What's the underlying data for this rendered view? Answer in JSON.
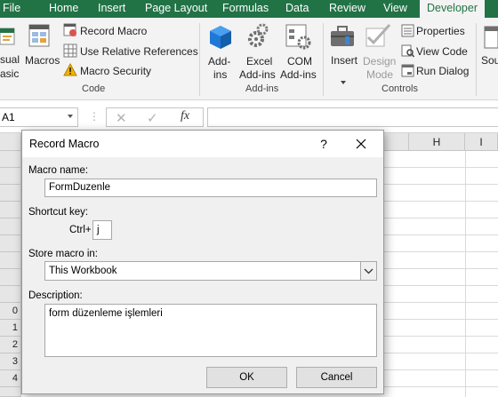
{
  "ribbon_tabs": [
    "File",
    "Home",
    "Insert",
    "Page Layout",
    "Formulas",
    "Data",
    "Review",
    "View",
    "Developer"
  ],
  "code_group": {
    "visual_basic_label_1": "sual",
    "visual_basic_label_2": "asic",
    "macros_label": "Macros",
    "record_macro_label": "Record Macro",
    "relative_refs_label": "Use Relative References",
    "macro_security_label": "Macro Security",
    "group_label": "Code"
  },
  "addins_group": {
    "addins_label_1": "Add-",
    "addins_label_2": "ins",
    "excel_addins_label_1": "Excel",
    "excel_addins_label_2": "Add-ins",
    "com_addins_label_1": "COM",
    "com_addins_label_2": "Add-ins",
    "group_label": "Add-ins"
  },
  "controls_group": {
    "insert_label": "Insert",
    "design_mode_label_1": "Design",
    "design_mode_label_2": "Mode",
    "properties_label": "Properties",
    "view_code_label": "View Code",
    "run_dialog_label": "Run Dialog",
    "group_label": "Controls"
  },
  "source_label": "Sou",
  "formula_bar": {
    "name_box": "A1",
    "fx_label": "fx",
    "formula_value": ""
  },
  "columns": [
    "H",
    "I"
  ],
  "rows": [
    "0",
    "1",
    "2",
    "3",
    "4"
  ],
  "dialog": {
    "title": "Record Macro",
    "help_label": "?",
    "macro_name_label": "Macro name:",
    "macro_name_value": "FormDuzenle",
    "shortcut_key_label": "Shortcut key:",
    "ctrl_label": "Ctrl+",
    "shortcut_value": "j",
    "store_macro_label": "Store macro in:",
    "store_macro_value": "This Workbook",
    "description_label": "Description:",
    "description_value": "form düzenleme işlemleri",
    "ok_label": "OK",
    "cancel_label": "Cancel"
  },
  "colors": {
    "excel_green": "#217346",
    "ribbon_bg": "#f3f3f3",
    "dialog_bg": "#f0f0f0"
  }
}
